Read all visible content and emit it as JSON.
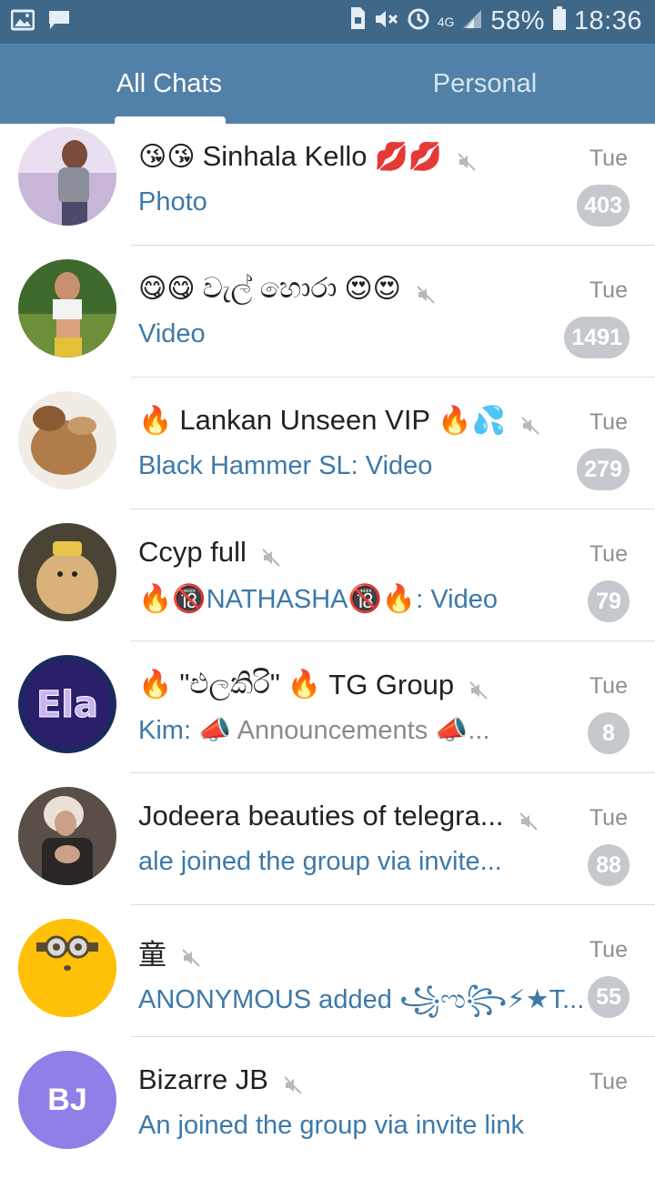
{
  "statusbar": {
    "battery": "58%",
    "time": "18:36",
    "network": "4G"
  },
  "tabs": [
    {
      "label": "All Chats",
      "active": true
    },
    {
      "label": "Personal",
      "active": false
    }
  ],
  "chats": [
    {
      "name": "Sinhala Kello",
      "name_prefix": "😘😘",
      "name_suffix": "💋💋",
      "preview": "Photo",
      "time": "Tue",
      "unread": "403",
      "muted": true
    },
    {
      "name": "වැල් හොරා",
      "name_prefix": "😋😋",
      "name_suffix": "😍😍",
      "preview": "Video",
      "time": "Tue",
      "unread": "1491",
      "muted": true
    },
    {
      "name": "Lankan Unseen VIP",
      "name_prefix": "🔥",
      "name_suffix": "🔥💦",
      "preview": "Black Hammer SL: Video",
      "time": "Tue",
      "unread": "279",
      "muted": true
    },
    {
      "name": "Ccyp full",
      "preview_prefix": "🔥🔞",
      "preview_name": "NATHASHA",
      "preview_mid": "🔞🔥",
      "preview": ": Video",
      "time": "Tue",
      "unread": "79",
      "muted": true
    },
    {
      "name": "\"එලකිරි\"",
      "name_prefix": "🔥",
      "name_mid": "🔥",
      "name_suffix": "TG Group",
      "preview_sender": "Kim:",
      "preview": "📣 Announcements 📣...",
      "time": "Tue",
      "unread": "8",
      "muted": true
    },
    {
      "name": "Jodeera beauties of telegra...",
      "preview": "ale joined the group via invite...",
      "time": "Tue",
      "unread": "88",
      "muted": true
    },
    {
      "name": "童",
      "preview": "ANONYMOUS added ꧁ಌ꧂⚡★T...",
      "time": "Tue",
      "unread": "55",
      "muted": true
    },
    {
      "name": "Bizarre JB",
      "initials": "BJ",
      "preview": "An joined the group via invite link",
      "time": "Tue",
      "unread": "",
      "muted": true
    }
  ],
  "colors": {
    "statusbar": "#3f6787",
    "tabbar": "#5181a8",
    "preview_link": "#3d79a8",
    "badge": "#c5c8cc",
    "avatar_bj": "#8f7fe6",
    "avatar_minion": "#ffc107"
  }
}
